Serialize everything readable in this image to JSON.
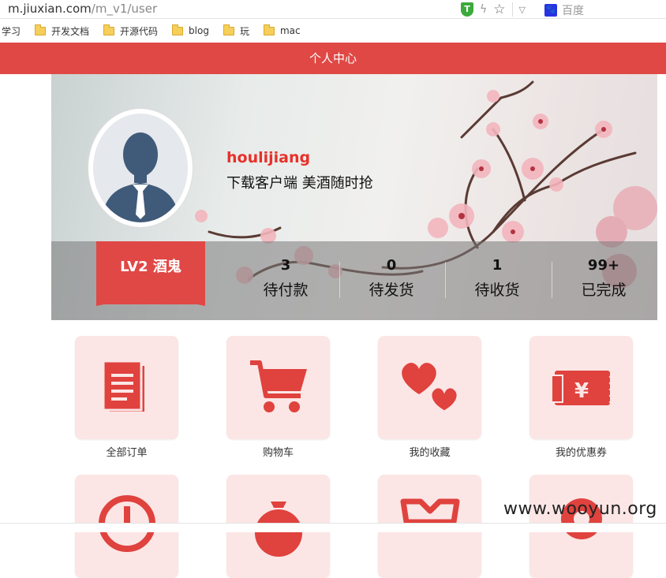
{
  "browser": {
    "url_host": "m.jiuxian.com",
    "url_path": "/m_v1/user",
    "shield_badge": "T",
    "search_engine": "百度",
    "bookmarks": [
      {
        "label": "学习",
        "folder": false
      },
      {
        "label": "开发文档",
        "folder": true
      },
      {
        "label": "开源代码",
        "folder": true
      },
      {
        "label": "blog",
        "folder": true
      },
      {
        "label": "玩",
        "folder": true
      },
      {
        "label": "mac",
        "folder": true
      }
    ]
  },
  "header": {
    "title": "个人中心"
  },
  "profile": {
    "username": "houlijiang",
    "tagline": "下载客户端 美酒随时抢",
    "level": "LV2 酒鬼"
  },
  "stats": [
    {
      "count": "3",
      "label": "待付款"
    },
    {
      "count": "0",
      "label": "待发货"
    },
    {
      "count": "1",
      "label": "待收货"
    },
    {
      "count": "99+",
      "label": "已完成"
    }
  ],
  "menu": [
    {
      "label": "全部订单",
      "icon": "document-icon"
    },
    {
      "label": "购物车",
      "icon": "cart-icon"
    },
    {
      "label": "我的收藏",
      "icon": "hearts-icon"
    },
    {
      "label": "我的优惠券",
      "icon": "coupon-icon"
    }
  ],
  "menu_row2_icons": [
    "clock-icon",
    "money-bag-icon",
    "gift-icon",
    "location-pin-icon"
  ],
  "watermark": "www.wooyun.org",
  "colors": {
    "accent": "#e04845",
    "tile_bg": "#fbe6e5",
    "username": "#e8302a"
  }
}
